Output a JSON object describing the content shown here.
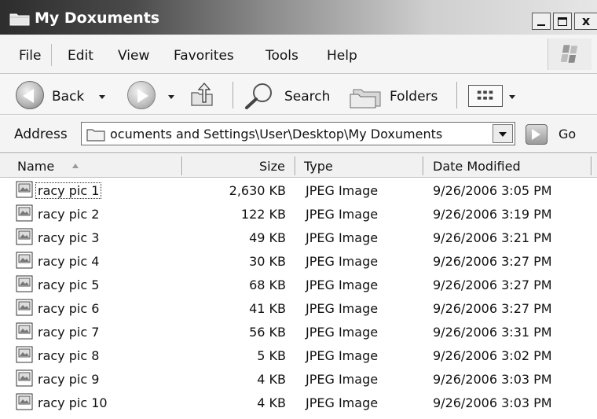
{
  "window": {
    "title": "My Doxuments",
    "controls": {
      "minimize": "_",
      "maximize": "□",
      "close": "x"
    }
  },
  "menu": [
    "File",
    "Edit",
    "View",
    "Favorites",
    "Tools",
    "Help"
  ],
  "toolbar": {
    "back_label": "Back",
    "search_label": "Search",
    "folders_label": "Folders",
    "icons": [
      "back-arrow-icon",
      "forward-arrow-icon",
      "up-folder-icon",
      "search-icon",
      "folders-icon",
      "views-icon"
    ]
  },
  "address": {
    "label": "Address",
    "value": "ocuments and Settings\\User\\Desktop\\My Doxuments",
    "go_label": "Go"
  },
  "columns": {
    "name": "Name",
    "size": "Size",
    "type": "Type",
    "date": "Date Modified"
  },
  "files": [
    {
      "name": "racy pic 1",
      "size": "2,630 KB",
      "type": "JPEG Image",
      "date": "9/26/2006 3:05 PM"
    },
    {
      "name": "racy pic 2",
      "size": "122 KB",
      "type": "JPEG Image",
      "date": "9/26/2006 3:19 PM"
    },
    {
      "name": "racy pic 3",
      "size": "49 KB",
      "type": "JPEG Image",
      "date": "9/26/2006 3:21 PM"
    },
    {
      "name": "racy pic 4",
      "size": "30 KB",
      "type": "JPEG Image",
      "date": "9/26/2006 3:27 PM"
    },
    {
      "name": "racy pic 5",
      "size": "68 KB",
      "type": "JPEG Image",
      "date": "9/26/2006 3:27 PM"
    },
    {
      "name": "racy pic 6",
      "size": "41 KB",
      "type": "JPEG Image",
      "date": "9/26/2006 3:27 PM"
    },
    {
      "name": "racy pic 7",
      "size": "56 KB",
      "type": "JPEG Image",
      "date": "9/26/2006 3:31 PM"
    },
    {
      "name": "racy pic 8",
      "size": "5 KB",
      "type": "JPEG Image",
      "date": "9/26/2006 3:02 PM"
    },
    {
      "name": "racy pic 9",
      "size": "4 KB",
      "type": "JPEG Image",
      "date": "9/26/2006 3:03 PM"
    },
    {
      "name": "racy pic 10",
      "size": "4 KB",
      "type": "JPEG Image",
      "date": "9/26/2006 3:03 PM"
    }
  ]
}
